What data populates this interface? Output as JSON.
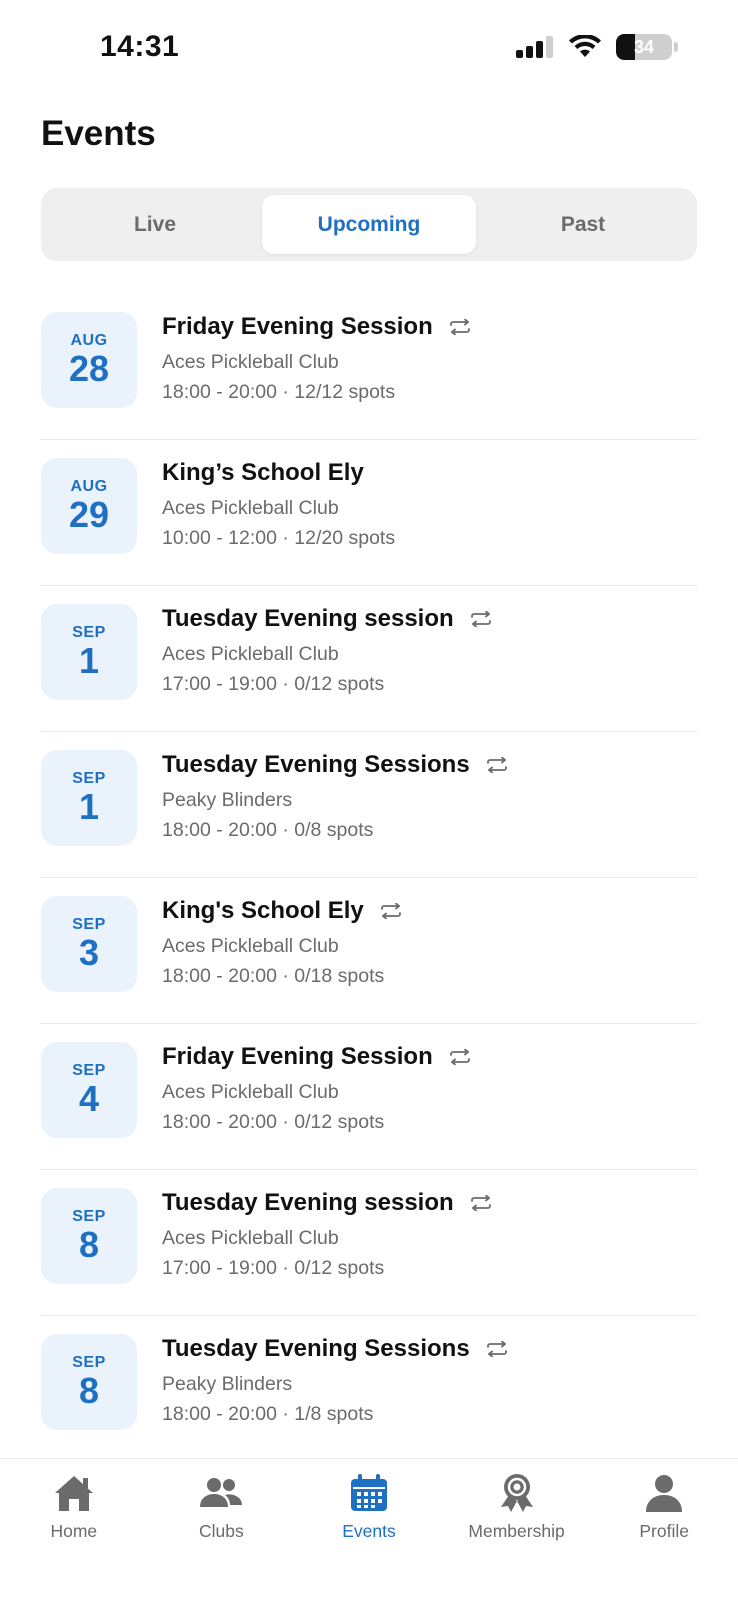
{
  "status_bar": {
    "time": "14:31",
    "battery_level": "34"
  },
  "header": {
    "title": "Events"
  },
  "tabs": [
    {
      "label": "Live",
      "active": false
    },
    {
      "label": "Upcoming",
      "active": true
    },
    {
      "label": "Past",
      "active": false
    }
  ],
  "events": [
    {
      "month": "AUG",
      "day": "28",
      "title": "Friday Evening Session",
      "recurring": true,
      "club": "Aces Pickleball Club",
      "details": "18:00 - 20:00 · 12/12 spots"
    },
    {
      "month": "AUG",
      "day": "29",
      "title": "King’s School Ely",
      "recurring": false,
      "club": "Aces Pickleball Club",
      "details": "10:00 - 12:00 · 12/20 spots"
    },
    {
      "month": "SEP",
      "day": "1",
      "title": "Tuesday Evening session",
      "recurring": true,
      "club": "Aces Pickleball Club",
      "details": "17:00 - 19:00 · 0/12 spots"
    },
    {
      "month": "SEP",
      "day": "1",
      "title": "Tuesday Evening Sessions",
      "recurring": true,
      "club": "Peaky Blinders",
      "details": "18:00 - 20:00 · 0/8 spots"
    },
    {
      "month": "SEP",
      "day": "3",
      "title": "King's School Ely",
      "recurring": true,
      "club": "Aces Pickleball Club",
      "details": "18:00 - 20:00 · 0/18 spots"
    },
    {
      "month": "SEP",
      "day": "4",
      "title": "Friday Evening Session",
      "recurring": true,
      "club": "Aces Pickleball Club",
      "details": "18:00 - 20:00 · 0/12 spots"
    },
    {
      "month": "SEP",
      "day": "8",
      "title": "Tuesday Evening session",
      "recurring": true,
      "club": "Aces Pickleball Club",
      "details": "17:00 - 19:00 · 0/12 spots"
    },
    {
      "month": "SEP",
      "day": "8",
      "title": "Tuesday Evening Sessions",
      "recurring": true,
      "club": "Peaky Blinders",
      "details": "18:00 - 20:00 · 1/8 spots"
    }
  ],
  "tab_bar": {
    "items": [
      {
        "label": "Home",
        "icon": "home-icon",
        "active": false
      },
      {
        "label": "Clubs",
        "icon": "clubs-icon",
        "active": false
      },
      {
        "label": "Events",
        "icon": "calendar-icon",
        "active": true
      },
      {
        "label": "Membership",
        "icon": "membership-icon",
        "active": false
      },
      {
        "label": "Profile",
        "icon": "profile-icon",
        "active": false
      }
    ]
  },
  "colors": {
    "accent": "#1f6fc2",
    "badge_bg": "#eaf3fc",
    "muted_text": "#6b6b6b",
    "inactive_icon": "#6b6b6b",
    "segment_bg": "#efefef"
  }
}
